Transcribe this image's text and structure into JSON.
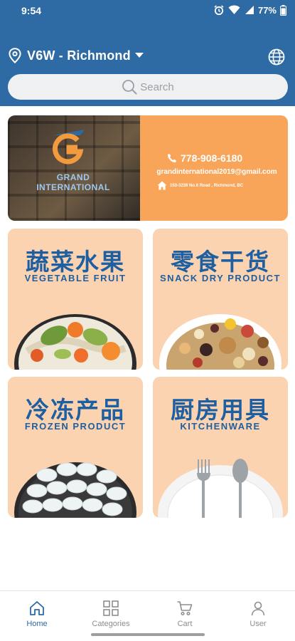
{
  "status_bar": {
    "time": "9:54",
    "battery_percent": "77%",
    "icons": [
      "alarm-icon",
      "wifi-icon",
      "signal-icon",
      "battery-icon"
    ]
  },
  "header": {
    "location": "V6W - Richmond",
    "search_placeholder": "Search",
    "background_color": "#2e6aa3"
  },
  "banner": {
    "logo_text": "GRAND INTERNATIONAL",
    "phone": "778-908-6180",
    "email": "grandinternational2019@gmail.com",
    "address": "153-3239 No.6 Road , Richmond, BC",
    "accent_color": "#f8a55a"
  },
  "categories": [
    {
      "zh": "蔬菜水果",
      "en": "VEGETABLE FRUIT",
      "image": "vegetable-fruit-plate"
    },
    {
      "zh": "零食干货",
      "en": "SNACK DRY PRODUCT",
      "image": "mixed-nuts-plate"
    },
    {
      "zh": "冷冻产品",
      "en": "FROZEN PRODUCT",
      "image": "shrimp-plate"
    },
    {
      "zh": "厨房用具",
      "en": "KITCHENWARE",
      "image": "fork-spoon-plate"
    }
  ],
  "bottom_nav": [
    {
      "label": "Home",
      "icon": "home-icon",
      "active": true
    },
    {
      "label": "Categories",
      "icon": "grid-icon",
      "active": false
    },
    {
      "label": "Cart",
      "icon": "cart-icon",
      "active": false
    },
    {
      "label": "User",
      "icon": "user-icon",
      "active": false
    }
  ],
  "colors": {
    "card_background": "#fcd3b0",
    "card_text": "#1d5fa0",
    "active_nav": "#2e6aa3"
  }
}
